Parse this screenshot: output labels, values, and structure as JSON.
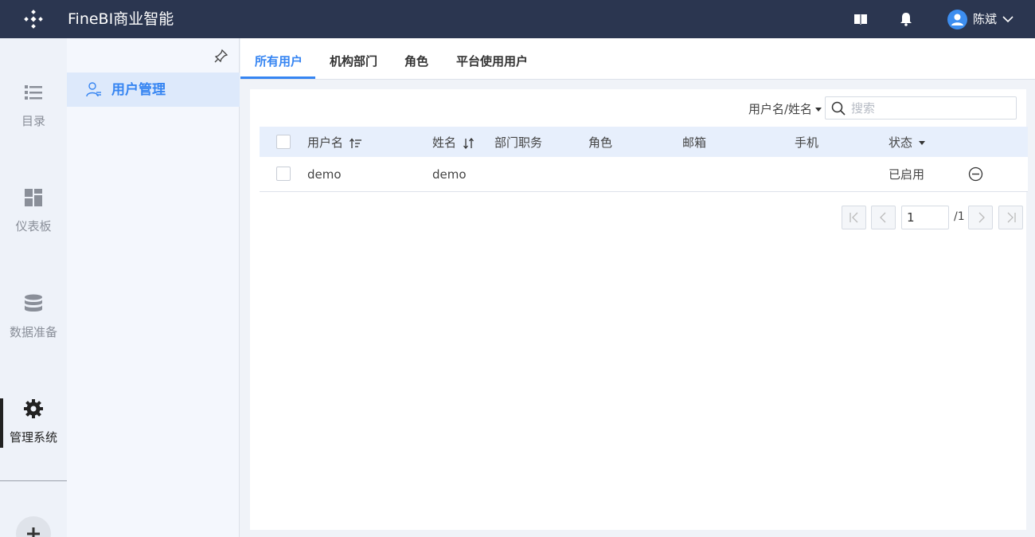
{
  "app": {
    "title": "FineBI商业智能"
  },
  "header": {
    "user_name": "陈斌"
  },
  "nav": {
    "items": [
      {
        "label": "目录",
        "icon": "list-icon"
      },
      {
        "label": "仪表板",
        "icon": "dashboard-icon"
      },
      {
        "label": "数据准备",
        "icon": "database-icon"
      },
      {
        "label": "管理系统",
        "icon": "gear-icon",
        "active": true
      }
    ]
  },
  "subpanel": {
    "item_label": "用户管理"
  },
  "tabs": [
    {
      "label": "所有用户",
      "active": true
    },
    {
      "label": "机构部门"
    },
    {
      "label": "角色"
    },
    {
      "label": "平台使用用户"
    }
  ],
  "filter": {
    "field_label": "用户名/姓名",
    "search_placeholder": "搜索"
  },
  "table": {
    "columns": [
      "用户名",
      "姓名",
      "部门职务",
      "角色",
      "邮箱",
      "手机",
      "状态"
    ],
    "rows": [
      {
        "username": "demo",
        "name": "demo",
        "department": "",
        "role": "",
        "email": "",
        "phone": "",
        "status": "已启用"
      }
    ]
  },
  "pagination": {
    "current": "1",
    "total": "/1"
  },
  "colors": {
    "accent": "#3685f2",
    "topbar": "#2b3650",
    "header_row": "#e7effc"
  }
}
